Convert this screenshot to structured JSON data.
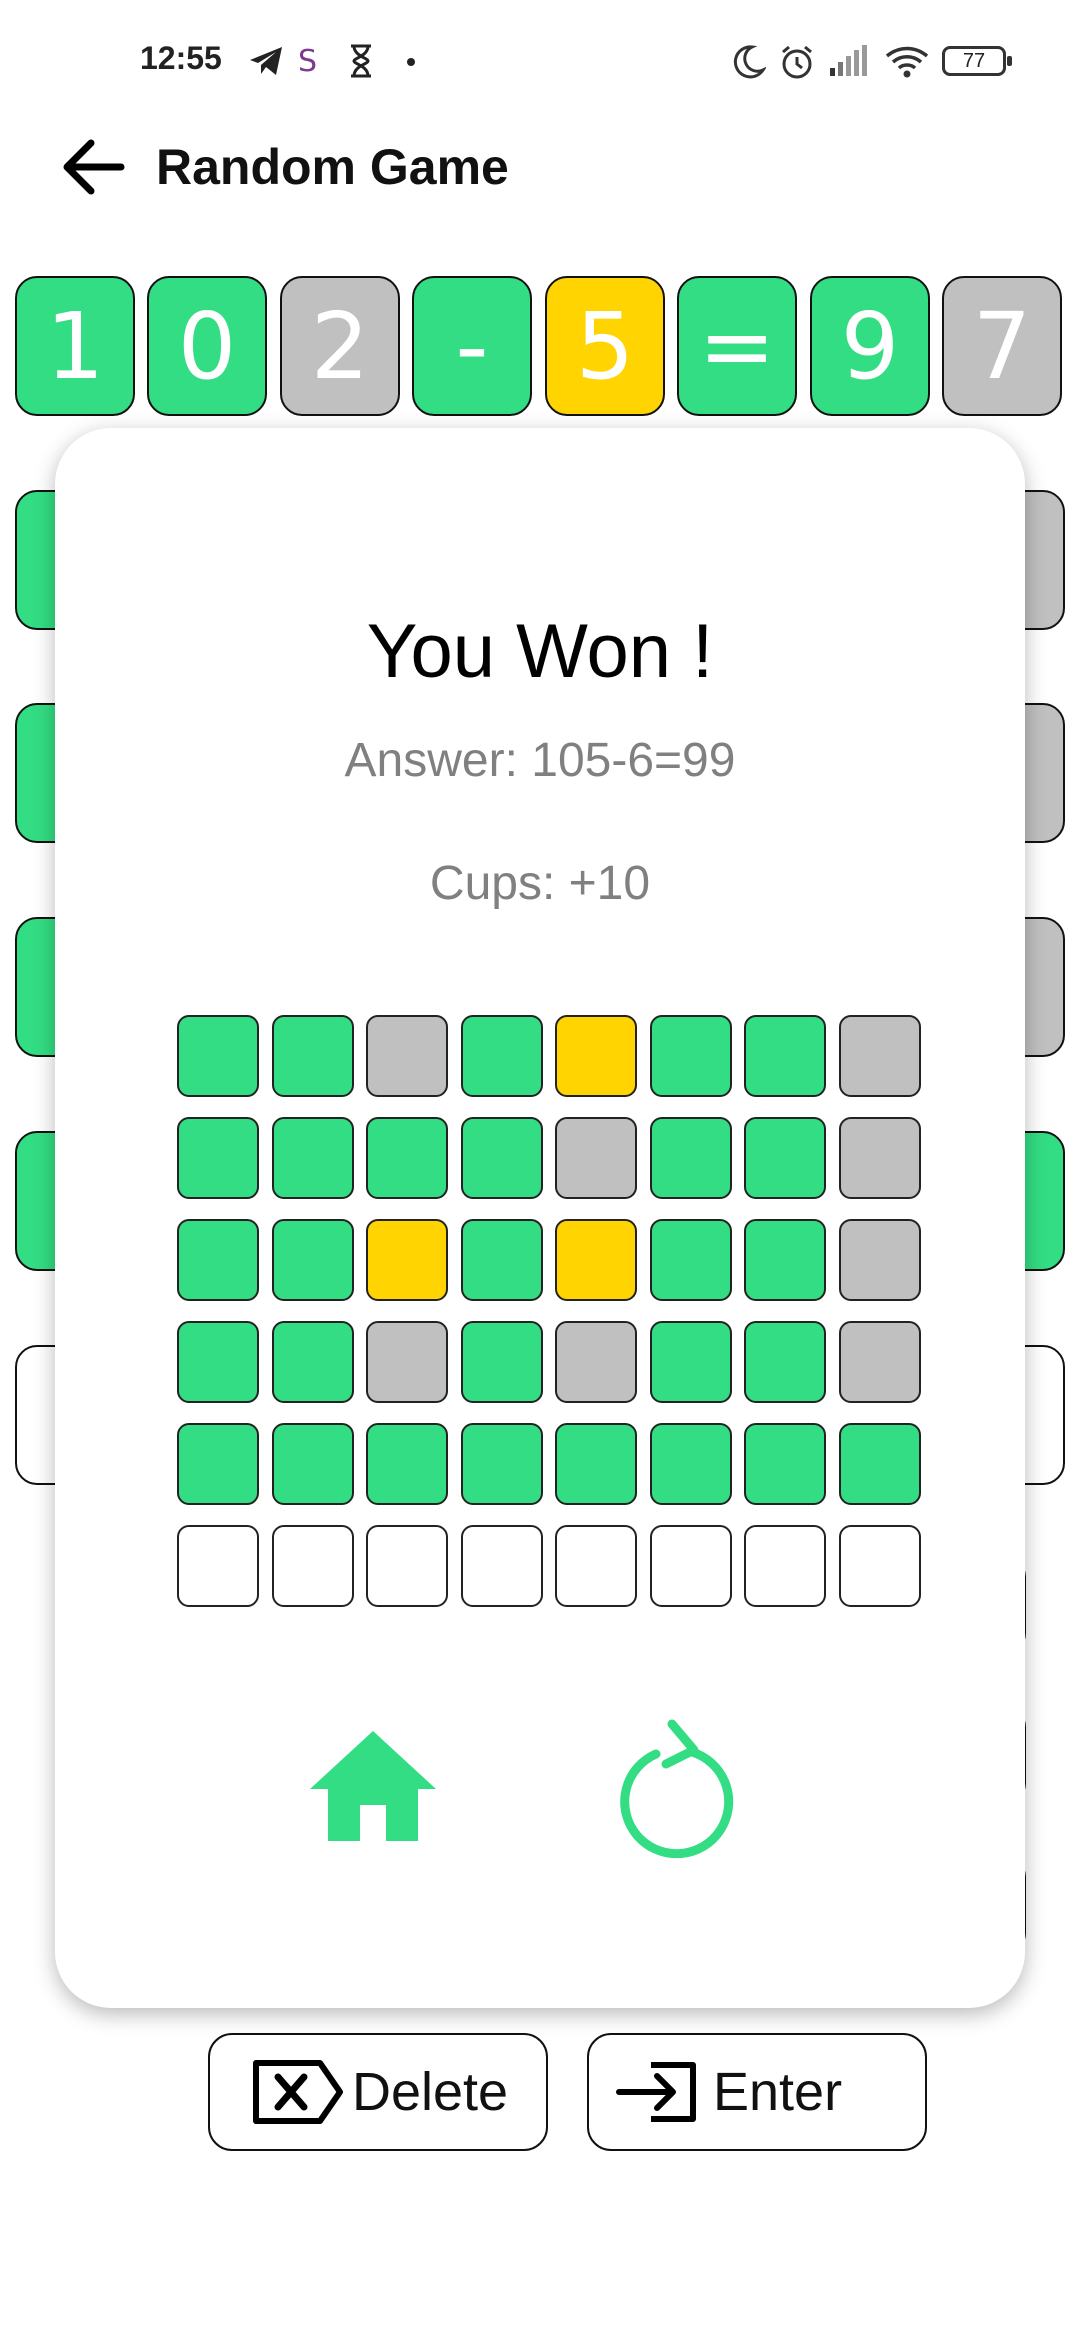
{
  "status_bar": {
    "time": "12:55",
    "battery": "77",
    "icons": [
      "telegram-icon",
      "s-app-icon",
      "hourglass-icon",
      "dot-icon",
      "moon-icon",
      "alarm-icon",
      "signal-icon",
      "wifi-icon",
      "battery-icon"
    ]
  },
  "header": {
    "title": "Random Game",
    "back_icon": "arrow-left-icon"
  },
  "board": {
    "current_row": [
      {
        "char": "1",
        "state": "green"
      },
      {
        "char": "0",
        "state": "green"
      },
      {
        "char": "2",
        "state": "gray"
      },
      {
        "char": "-",
        "state": "green"
      },
      {
        "char": "5",
        "state": "yellow"
      },
      {
        "char": "=",
        "state": "green"
      },
      {
        "char": "9",
        "state": "green"
      },
      {
        "char": "7",
        "state": "gray"
      }
    ]
  },
  "modal": {
    "title": "You Won !",
    "answer": "Answer: 105-6=99",
    "cups": "Cups: +10",
    "grid": [
      [
        "green",
        "green",
        "gray",
        "green",
        "yellow",
        "green",
        "green",
        "gray"
      ],
      [
        "green",
        "green",
        "green",
        "green",
        "gray",
        "green",
        "green",
        "gray"
      ],
      [
        "green",
        "green",
        "yellow",
        "green",
        "yellow",
        "green",
        "green",
        "gray"
      ],
      [
        "green",
        "green",
        "gray",
        "green",
        "gray",
        "green",
        "green",
        "gray"
      ],
      [
        "green",
        "green",
        "green",
        "green",
        "green",
        "green",
        "green",
        "green"
      ],
      [
        "empty",
        "empty",
        "empty",
        "empty",
        "empty",
        "empty",
        "empty",
        "empty"
      ]
    ],
    "home_icon": "home-icon",
    "replay_icon": "replay-icon"
  },
  "keyboard": {
    "delete_label": "Delete",
    "enter_label": "Enter"
  },
  "colors": {
    "green": "#33dd83",
    "yellow": "#ffd400",
    "gray": "#c0c0c0",
    "accent": "#33dd83"
  }
}
